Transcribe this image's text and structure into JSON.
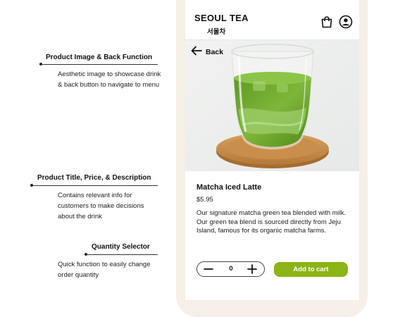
{
  "annotations": [
    {
      "title": "Product Image & Back Function",
      "description": "Aesthetic image to showcase drink & back button to navigate to menu"
    },
    {
      "title": "Product Title, Price, & Description",
      "description": "Contains relevant info for customers to make decisions about the drink"
    },
    {
      "title": "Quantity Selector",
      "description": "Quick function to easily change order quantity"
    }
  ],
  "header": {
    "brand": "SEOUL TEA",
    "brand_korean": "서울차",
    "cart_icon": "shopping-bag-icon",
    "profile_icon": "user-circle-icon"
  },
  "hero": {
    "back_label": "Back",
    "back_icon": "arrow-left-icon",
    "image": "matcha-latte-glass-on-wooden-coaster"
  },
  "product": {
    "title": "Matcha Iced Latte",
    "price": "$5.95",
    "description": "Our signature matcha green tea blended with milk. Our green tea blend is sourced directly from Jeju Island, famous for its organic matcha farms."
  },
  "quantity": {
    "value": "0",
    "minus_icon": "minus-icon",
    "plus_icon": "plus-icon"
  },
  "cta": {
    "label": "Add to cart",
    "color": "#8cb416"
  }
}
